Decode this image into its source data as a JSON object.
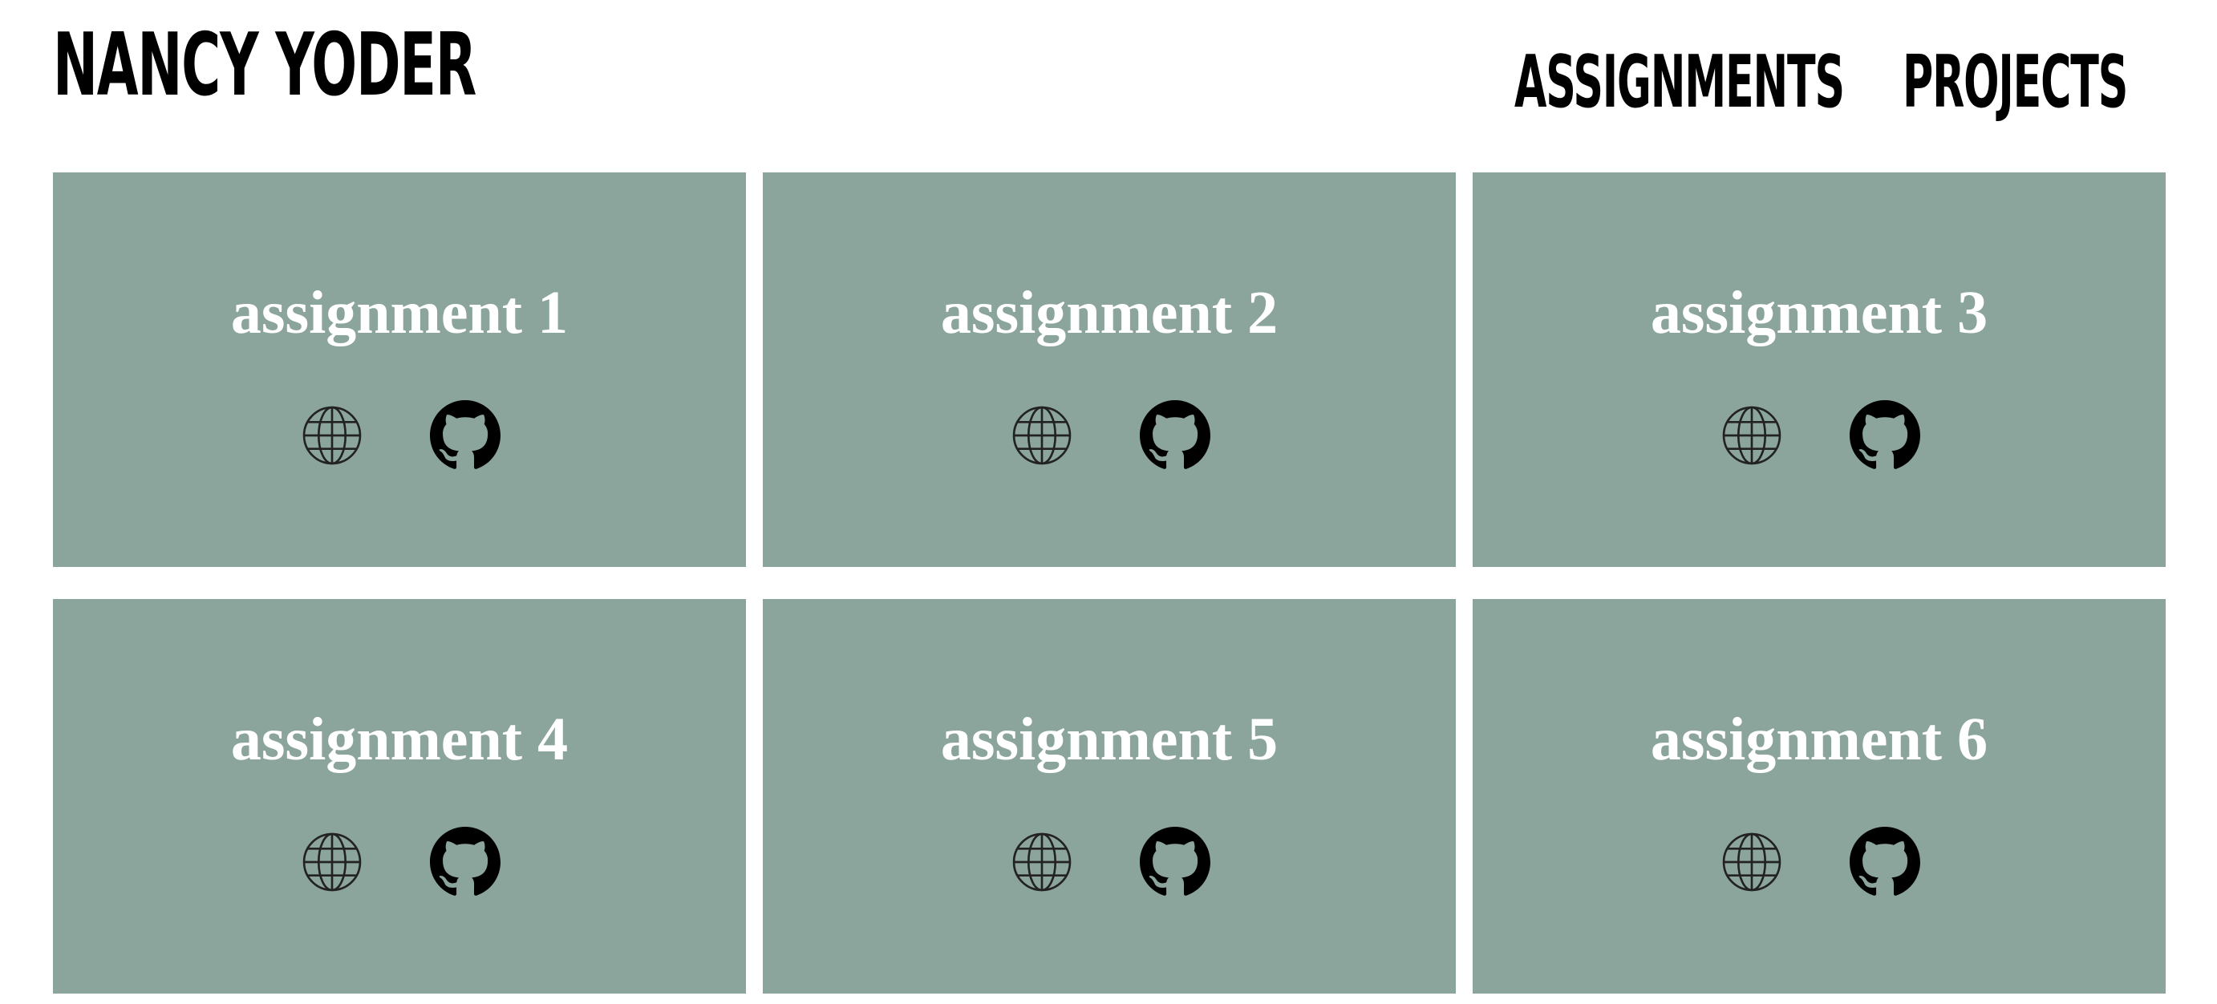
{
  "header": {
    "brand": "NANCY YODER",
    "nav": [
      {
        "label": "ASSIGNMENTS"
      },
      {
        "label": "PROJECTS"
      }
    ]
  },
  "cards": [
    {
      "title": "assignment 1",
      "icons": [
        "globe-icon",
        "github-icon"
      ]
    },
    {
      "title": "assignment 2",
      "icons": [
        "globe-icon",
        "github-icon"
      ]
    },
    {
      "title": "assignment 3",
      "icons": [
        "globe-icon",
        "github-icon"
      ]
    },
    {
      "title": "assignment 4",
      "icons": [
        "globe-icon",
        "github-icon"
      ]
    },
    {
      "title": "assignment 5",
      "icons": [
        "globe-icon",
        "github-icon"
      ]
    },
    {
      "title": "assignment 6",
      "icons": [
        "globe-icon",
        "github-icon"
      ]
    }
  ],
  "colors": {
    "card_background": "#8ba59d",
    "card_title": "#ffffff",
    "text": "#000000",
    "page_background": "#ffffff"
  }
}
